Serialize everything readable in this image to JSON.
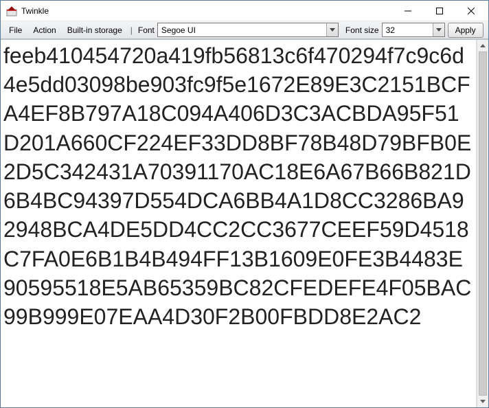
{
  "window": {
    "title": "Twinkle"
  },
  "menubar": {
    "file": "File",
    "action": "Action",
    "storage": "Built-in storage",
    "font_label": "Font",
    "font_value": "Segoe UI",
    "size_label": "Font size",
    "size_value": "32",
    "apply": "Apply"
  },
  "content": {
    "text": "feeb410454720a419fb56813c6f470294f7c9c6d4e5dd03098be903fc9f5e1672E89E3C2151BCFA4EF8B797A18C094A406D3C3ACBDA95F51D201A660CF224EF33DD8BF78B48D79BFB0E2D5C342431A70391170AC18E6A67B66B821D6B4BC94397D554DCA6BB4A1D8CC3286BA92948BCA4DE5DD4CC2CC3677CEEF59D4518C7FA0E6B1B4B494FF13B1609E0FE3B4483E90595518E5AB65359BC82CFEDEFE4F05BAC99B999E07EAA4D30F2B00FBDD8E2AC2"
  }
}
